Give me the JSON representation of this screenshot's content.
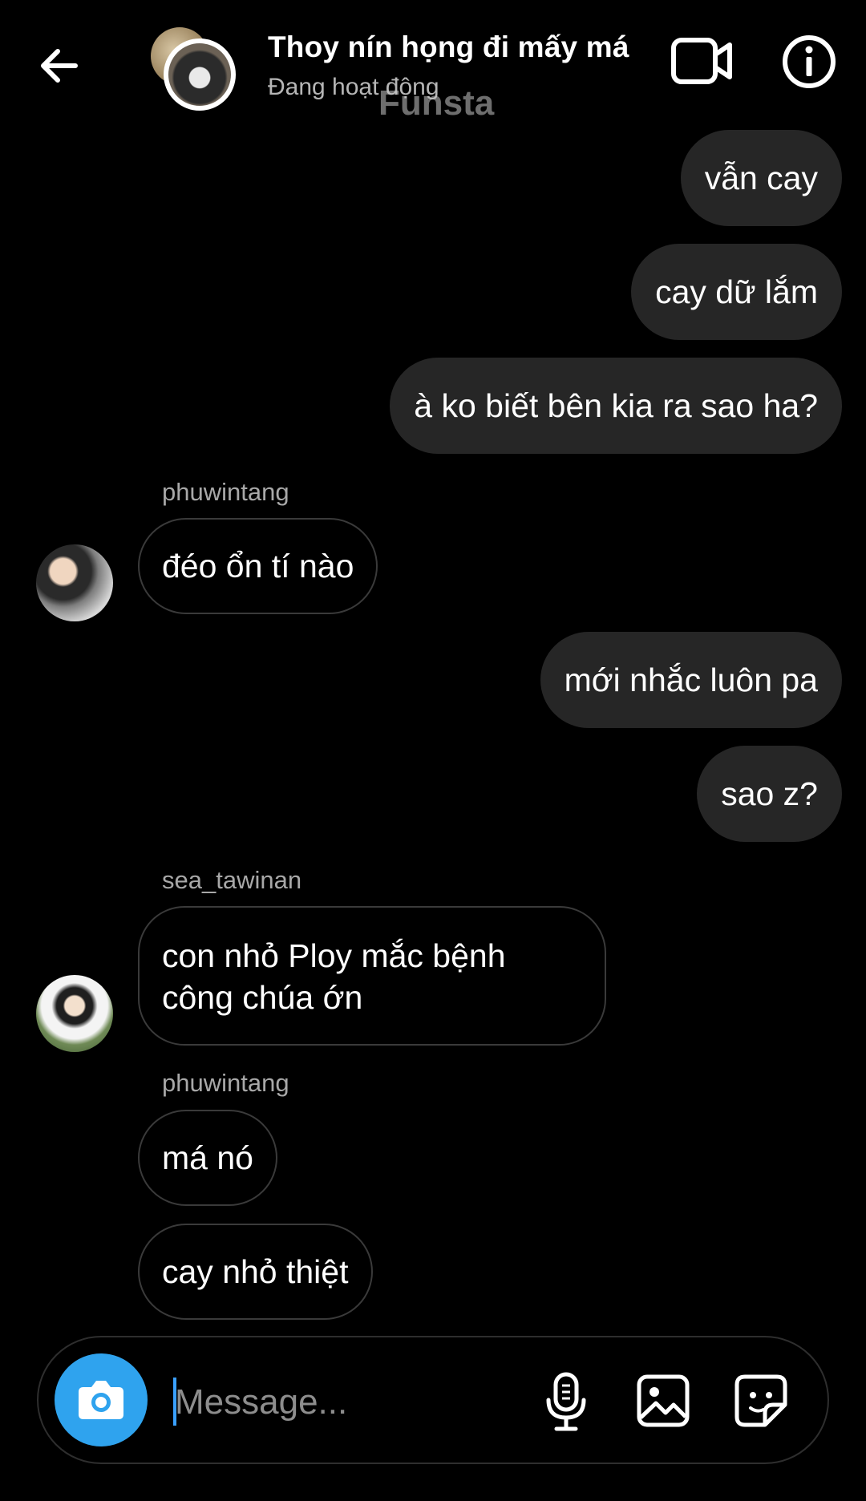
{
  "header": {
    "title": "Thoy nín họng đi mấy má",
    "status": "Đang hoạt động",
    "watermark": "Funsta"
  },
  "messages": [
    {
      "direction": "sent",
      "text": "vẫn cay"
    },
    {
      "direction": "sent",
      "text": "cay dữ lắm"
    },
    {
      "direction": "sent",
      "text": "à ko biết bên kia ra sao ha?"
    },
    {
      "direction": "received",
      "sender": "phuwintang",
      "text": "đéo ổn tí nào"
    },
    {
      "direction": "sent",
      "text": "mới nhắc luôn pa"
    },
    {
      "direction": "sent",
      "text": "sao z?"
    },
    {
      "direction": "received",
      "sender": "sea_tawinan",
      "text_line1": "con nhỏ Ploy mắc bệnh",
      "text_line2": "công chúa ớn"
    },
    {
      "direction": "received",
      "sender": "phuwintang",
      "text": "má nó"
    },
    {
      "direction": "received",
      "text": "cay nhỏ thiệt"
    }
  ],
  "composer": {
    "placeholder": "Message..."
  },
  "icons": {
    "back": "back-arrow-icon",
    "video": "video-call-icon",
    "info": "info-icon",
    "camera": "camera-icon",
    "mic": "microphone-icon",
    "gallery": "gallery-icon",
    "sticker": "sticker-icon"
  },
  "colors": {
    "background": "#000000",
    "sent_bubble": "#262626",
    "received_border": "#3a3a3a",
    "camera_button": "#2fa3ee"
  }
}
